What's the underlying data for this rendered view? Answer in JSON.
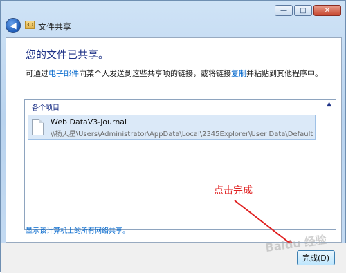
{
  "window": {
    "title": "文件共享",
    "controls": {
      "minimize": "—",
      "maximize": "□",
      "close": "✕"
    },
    "back_symbol": "◀",
    "app_icon_text": "3D"
  },
  "main": {
    "heading": "您的文件已共享。",
    "desc_prefix": "可通过",
    "desc_link_email": "电子邮件",
    "desc_middle": "向某个人发送到这些共享项的链接，或将链接",
    "desc_link_copy": "复制",
    "desc_suffix": "并粘贴到其他程序中。",
    "group": {
      "title": "各个项目",
      "toggle": "▲",
      "items": [
        {
          "name": "Web DataV3-journal",
          "path": "\\\\杨天星\\Users\\Administrator\\AppData\\Local\\2345Explorer\\User Data\\Default\\We..."
        }
      ]
    },
    "annotation": "点击完成",
    "show_all_link": "显示该计算机上的所有网络共享。"
  },
  "footer": {
    "finish_label": "完成(D)"
  },
  "watermark": "Baidu 经验",
  "colors": {
    "annotation": "#e02020",
    "link": "#0066cc",
    "heading": "#1e3287"
  }
}
